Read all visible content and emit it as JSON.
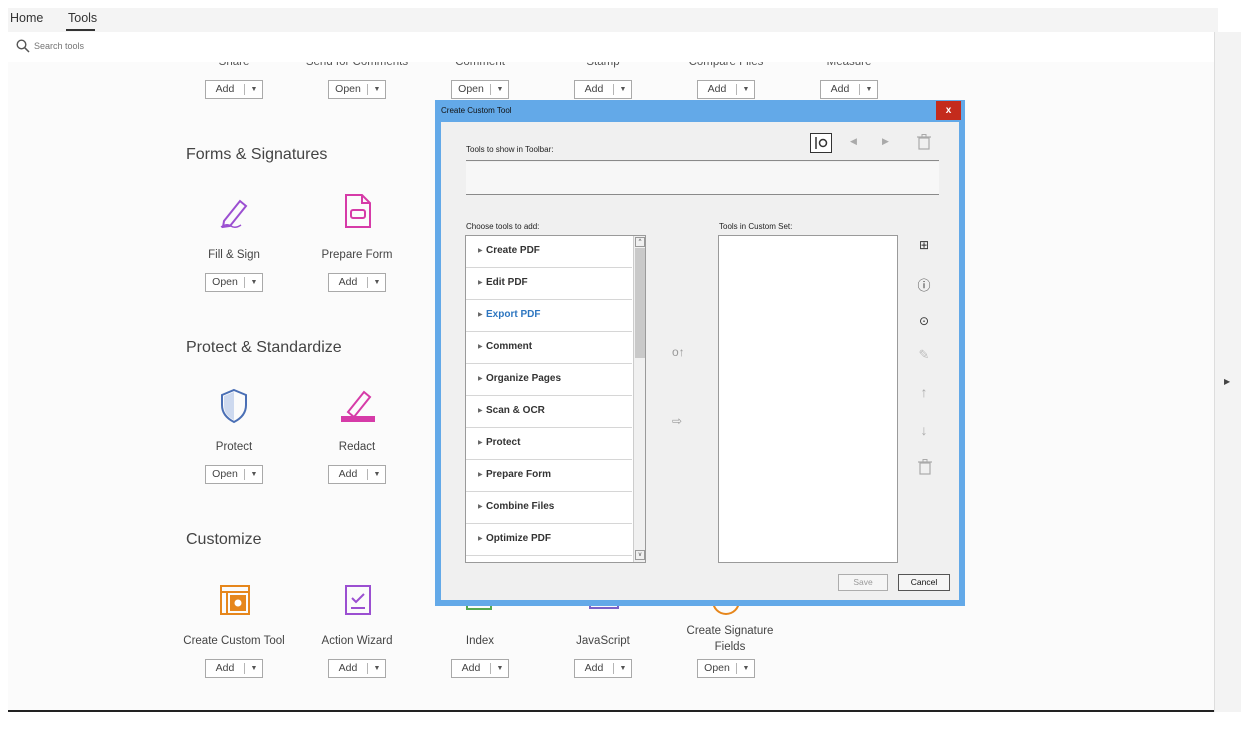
{
  "nav": {
    "home": "Home",
    "tools": "Tools"
  },
  "search": {
    "placeholder": "Search tools"
  },
  "top_row": [
    {
      "name": "Share",
      "button": "Add"
    },
    {
      "name": "Send for Comments",
      "button": "Open"
    },
    {
      "name": "Comment",
      "button": "Open"
    },
    {
      "name": "Stamp",
      "button": "Add"
    },
    {
      "name": "Compare Files",
      "button": "Add"
    },
    {
      "name": "Measure",
      "button": "Add"
    }
  ],
  "sections": {
    "forms": {
      "title": "Forms & Signatures",
      "tools": [
        {
          "name": "Fill & Sign",
          "button": "Open"
        },
        {
          "name": "Prepare Form",
          "button": "Add"
        }
      ]
    },
    "protect": {
      "title": "Protect & Standardize",
      "tools": [
        {
          "name": "Protect",
          "button": "Open"
        },
        {
          "name": "Redact",
          "button": "Add"
        }
      ]
    },
    "customize": {
      "title": "Customize",
      "tools": [
        {
          "name": "Create Custom Tool",
          "button": "Add"
        },
        {
          "name": "Action Wizard",
          "button": "Add"
        },
        {
          "name": "Index",
          "button": "Add"
        },
        {
          "name": "JavaScript",
          "button": "Add"
        },
        {
          "name": "Create Signature Fields",
          "button": "Open"
        }
      ]
    }
  },
  "dialog": {
    "title": "Create Custom Tool",
    "close": "x",
    "toolbar_label": "Tools to show in Toolbar:",
    "choose_label": "Choose tools to add:",
    "custom_set_label": "Tools in Custom Set:",
    "tools_list": [
      "Create PDF",
      "Edit PDF",
      "Export PDF",
      "Comment",
      "Organize Pages",
      "Scan & OCR",
      "Protect",
      "Prepare Form",
      "Combine Files",
      "Optimize PDF"
    ],
    "selected_tool": "Export PDF",
    "save": "Save",
    "cancel": "Cancel"
  },
  "colors": {
    "accent_blue": "#2d76c0",
    "dialog_border": "#63a9e8",
    "close_red": "#c42b1c",
    "purple_icon": "#9b4fd1",
    "magenta_icon": "#d63ba8",
    "orange_icon": "#e6861b"
  }
}
